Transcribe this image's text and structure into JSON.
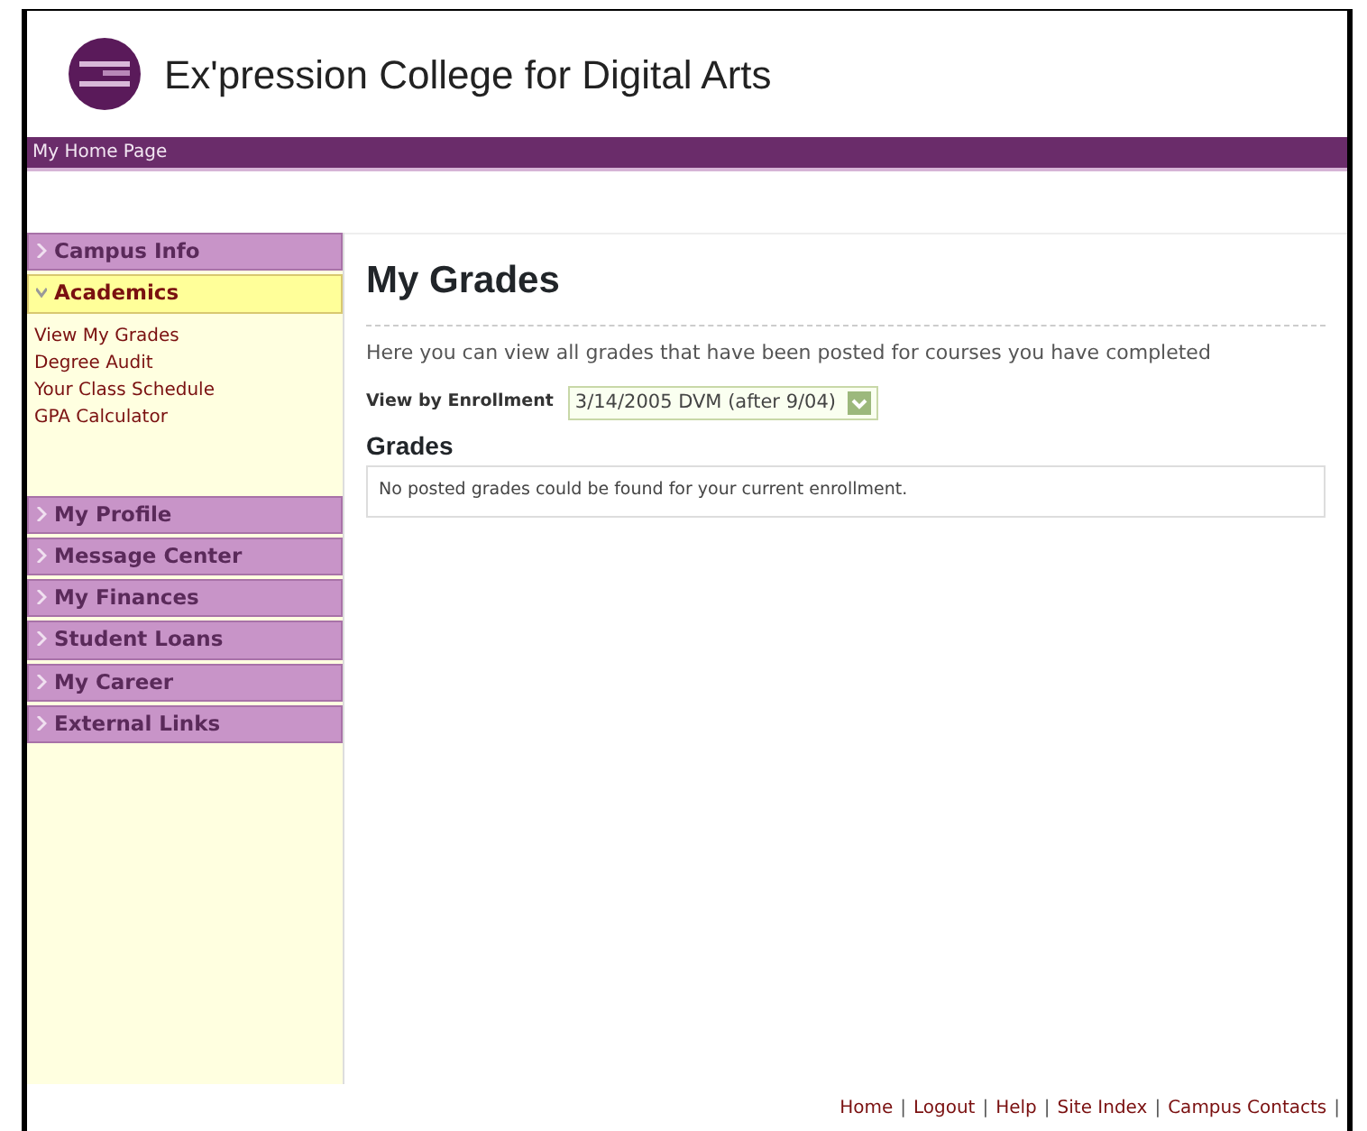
{
  "header": {
    "title": "Ex'pression College for Digital Arts"
  },
  "top_bar": {
    "link": "My Home Page"
  },
  "sidebar": {
    "items": [
      {
        "label": "Campus Info",
        "expanded": false
      },
      {
        "label": "Academics",
        "expanded": true,
        "children": [
          {
            "label": "View My Grades"
          },
          {
            "label": "Degree Audit"
          },
          {
            "label": "Your Class Schedule"
          },
          {
            "label": "GPA Calculator"
          }
        ]
      },
      {
        "label": "My Profile",
        "expanded": false
      },
      {
        "label": "Message Center",
        "expanded": false
      },
      {
        "label": "My Finances",
        "expanded": false
      },
      {
        "label": "Student Loans",
        "expanded": false
      },
      {
        "label": "My Career",
        "expanded": false
      },
      {
        "label": "External Links",
        "expanded": false
      }
    ]
  },
  "main": {
    "title": "My Grades",
    "intro": "Here you can view all grades that have been posted for courses you have completed",
    "enrollment": {
      "label": "View by Enrollment",
      "value": "3/14/2005 DVM (after 9/04)"
    },
    "section_title": "Grades",
    "message": "No posted grades could be found for your current enrollment."
  },
  "footer": {
    "separator": "|",
    "links": [
      "Home",
      "Logout",
      "Help",
      "Site Index",
      "Campus Contacts"
    ]
  }
}
